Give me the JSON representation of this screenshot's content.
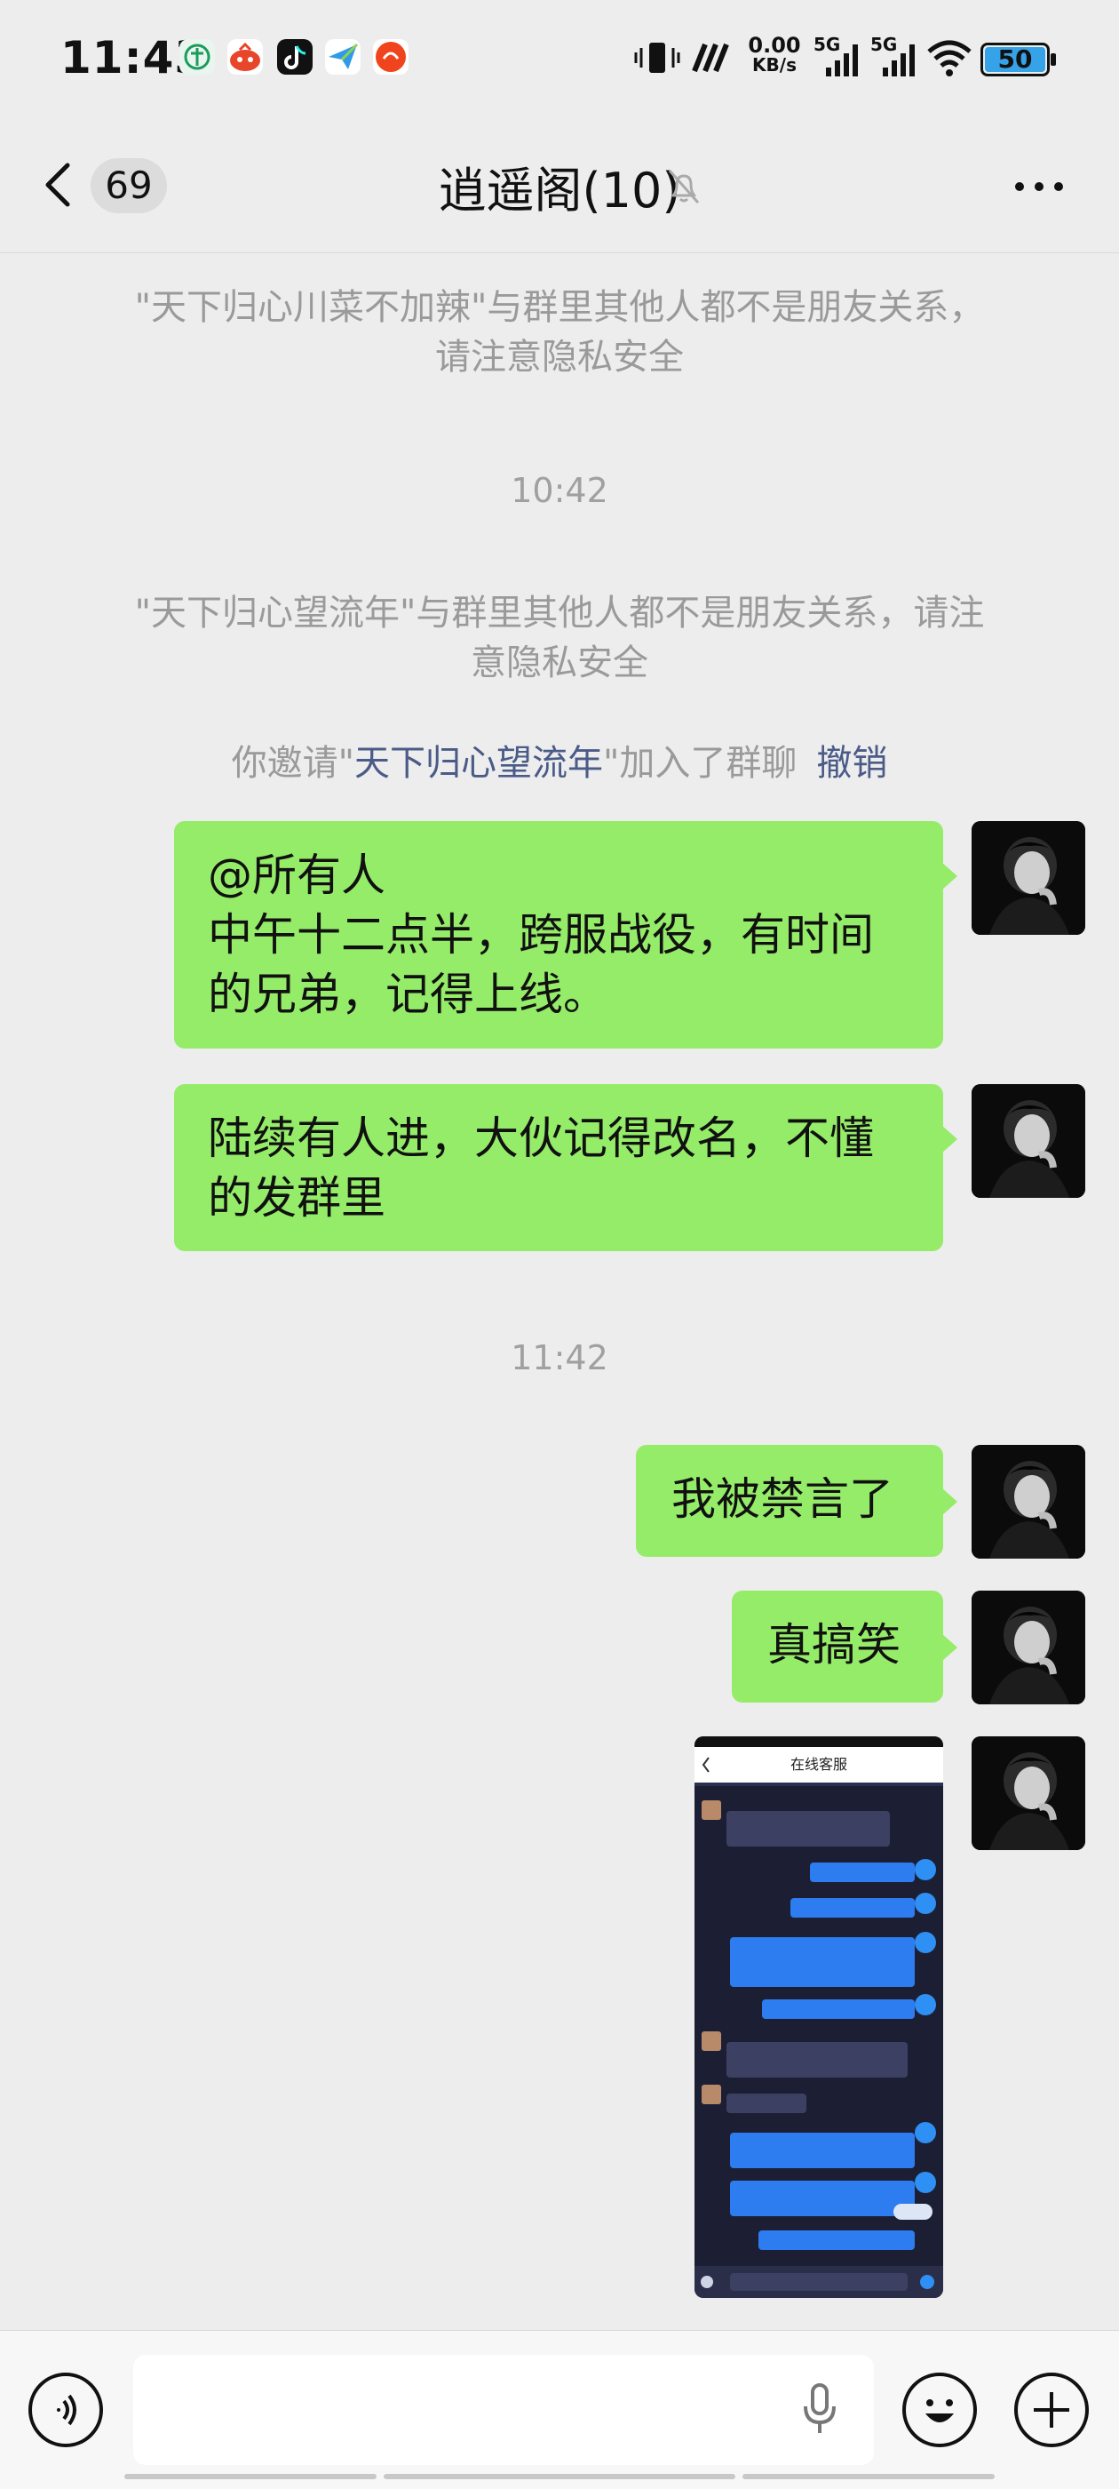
{
  "status_bar": {
    "time": "11:43",
    "net_speed_top": "0.00",
    "net_speed_unit": "KB/s",
    "sim1": "5G",
    "sim2": "5G",
    "battery": "50"
  },
  "header": {
    "unread_count": "69",
    "title": "逍遥阁(10)"
  },
  "messages": {
    "notice1_line1": "\"天下归心川菜不加辣\"与群里其他人都不是朋友关系，",
    "notice1_line2": "请注意隐私安全",
    "time1": "10:42",
    "notice2_line1": "\"天下归心望流年\"与群里其他人都不是朋友关系，请注",
    "notice2_line2": "意隐私安全",
    "invite_prefix": "你邀请\"",
    "invite_name": "天下归心望流年",
    "invite_suffix": "\"加入了群聊",
    "invite_revoke": "撤销",
    "msg1_line1": "@所有人",
    "msg1_line2": "中午十二点半，跨服战役，有时间",
    "msg1_line3": "的兄弟，记得上线。",
    "msg2_line1": "陆续有人进，大伙记得改名，不懂",
    "msg2_line2": "的发群里",
    "time2": "11:42",
    "msg3": "我被禁言了",
    "msg4": "真搞笑"
  },
  "screenshot_image": {
    "title": "在线客服"
  },
  "colors": {
    "bubble": "#95ec69",
    "background": "#ededed",
    "link": "#4a5b88"
  }
}
